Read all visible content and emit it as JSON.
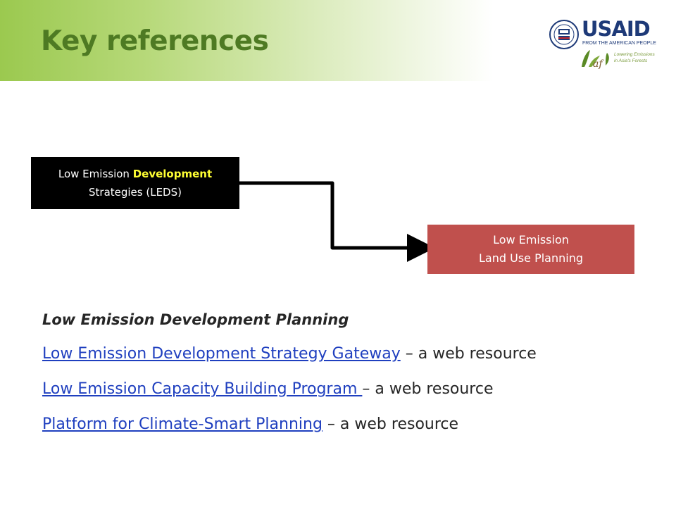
{
  "slide": {
    "title": "Key references"
  },
  "logos": {
    "usaid_main": "USAID",
    "usaid_tagline": "FROM THE AMERICAN PEOPLE",
    "leaf_line1": "Lowering Emissions",
    "leaf_line2": "in Asia's Forests",
    "leaf_mark": "leaf",
    "seal_icon": "usaid-seal-icon"
  },
  "diagram": {
    "source_box": {
      "line1_prefix": "Low Emission ",
      "line1_highlight": "Development",
      "line2": "Strategies (LEDS)"
    },
    "target_box": {
      "line1": "Low Emission",
      "line2": "Land Use Planning"
    }
  },
  "references": {
    "heading": "Low Emission Development Planning",
    "items": [
      {
        "link": "Low Emission Development Strategy Gateway",
        "suffix": " – a web resource"
      },
      {
        "link": "Low Emission Capacity Building Program ",
        "suffix": "– a web resource"
      },
      {
        "link": "Platform for Climate-Smart Planning",
        "suffix": " – a web resource"
      }
    ]
  },
  "colors": {
    "title_green": "#4e7a23",
    "highlight_yellow": "#ffff33",
    "target_box_red": "#c0504d",
    "link_blue": "#1f3fbf",
    "usaid_blue": "#1e3a78",
    "usaid_red": "#c1262d"
  }
}
